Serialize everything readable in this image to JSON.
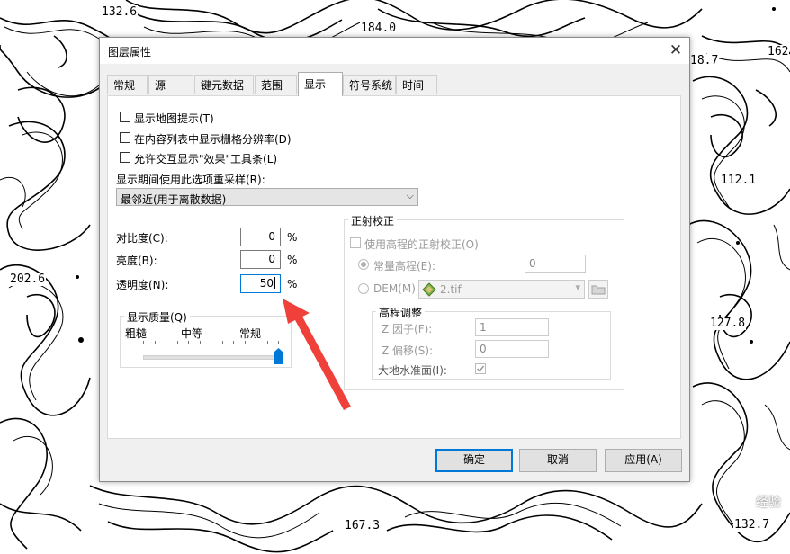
{
  "map": {
    "labels": [
      "132.6",
      "184.0",
      "202.6",
      "127.8",
      "167.3",
      "132.7",
      "162",
      "112.1",
      "18.7"
    ]
  },
  "dialog": {
    "title": "图层属性",
    "close": "✕",
    "tabs": [
      {
        "label": "常规",
        "active": false
      },
      {
        "label": "源",
        "active": false
      },
      {
        "label": "键元数据",
        "active": false
      },
      {
        "label": "范围",
        "active": false
      },
      {
        "label": "显示",
        "active": true
      },
      {
        "label": "符号系统",
        "active": false
      },
      {
        "label": "时间",
        "active": false
      }
    ],
    "display": {
      "checkboxes": [
        {
          "label": "显示地图提示(T)",
          "checked": false
        },
        {
          "label": "在内容列表中显示栅格分辨率(D)",
          "checked": false
        },
        {
          "label": "允许交互显示\"效果\"工具条(L)",
          "checked": false
        }
      ],
      "resample_label": "显示期间使用此选项重采样(R):",
      "resample_value": "最邻近(用于离散数据)",
      "contrast_label": "对比度(C):",
      "contrast_value": "0",
      "brightness_label": "亮度(B):",
      "brightness_value": "0",
      "transparency_label": "透明度(N):",
      "transparency_value": "50",
      "percent": "%",
      "quality": {
        "title": "显示质量(Q)",
        "ticks": [
          "粗糙",
          "中等",
          "常规"
        ],
        "level": 1.0
      },
      "ortho": {
        "title": "正射校正",
        "use_elevation_label": "使用高程的正射校正(O)",
        "constant_label": "常量高程(E):",
        "constant_value": "0",
        "dem_label": "DEM(M)",
        "dem_value": "2.tif",
        "elev_adjust": {
          "title": "高程调整",
          "z_factor_label": "Z 因子(F):",
          "z_factor_value": "1",
          "z_offset_label": "Z 偏移(S):",
          "z_offset_value": "0",
          "geoid_label": "大地水准面(I):"
        }
      }
    },
    "buttons": {
      "ok": "确定",
      "cancel": "取消",
      "apply": "应用(A)"
    }
  },
  "annotation": {
    "arrow_color": "#f0403a"
  },
  "watermark": "经验"
}
